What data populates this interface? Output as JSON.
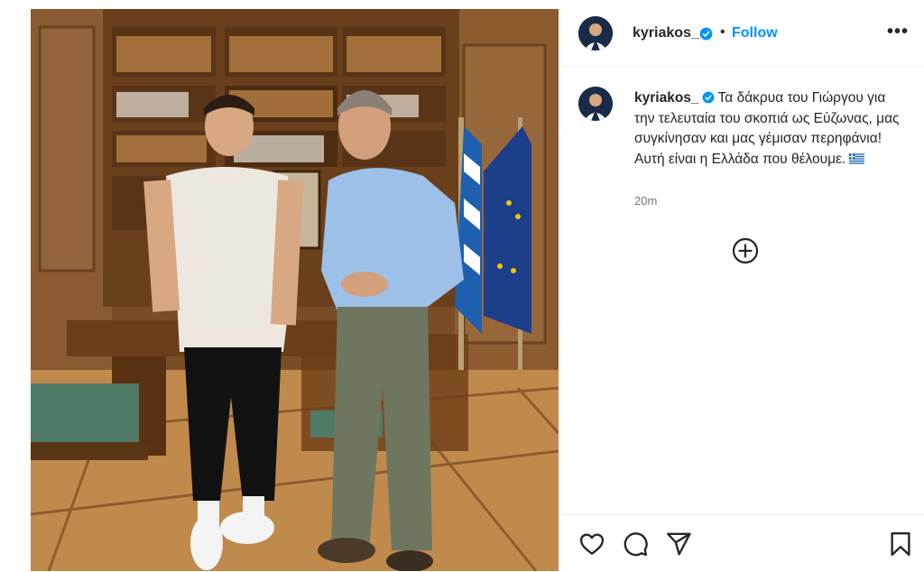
{
  "header": {
    "username": "kyriakos_",
    "separator": "•",
    "follow_label": "Follow",
    "more_label": "•••"
  },
  "caption": {
    "username": "kyriakos_",
    "text": "Τα δάκρυα του Γιώργου για την τελευταία του σκοπιά ως Εύζωνας, μας συγκίνησαν και μας γέμισαν περηφάνια! Αυτή είναι η Ελλάδα που θέλουμε.",
    "timestamp": "20m"
  },
  "icons": {
    "verified": "verified-badge-icon",
    "flag": "greek-flag-emoji",
    "add_comment": "plus-circle-icon",
    "like": "heart-icon",
    "comment": "comment-bubble-icon",
    "share": "paper-plane-icon",
    "save": "bookmark-icon"
  },
  "colors": {
    "link_blue": "#0095f6",
    "verified_blue": "#0095f6",
    "text": "#262626",
    "muted": "#737373"
  }
}
